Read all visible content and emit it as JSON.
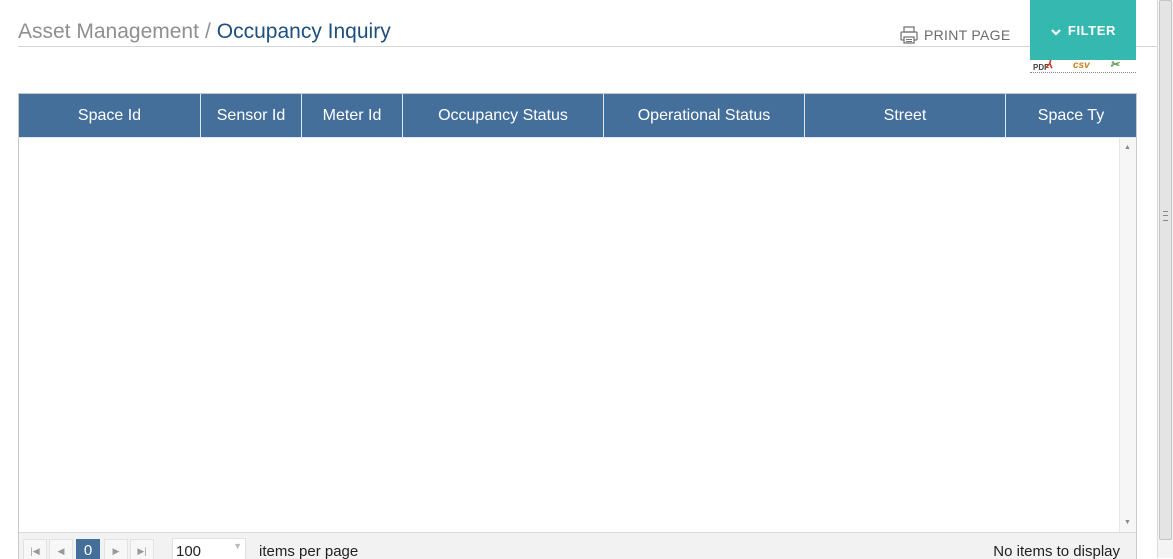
{
  "breadcrumb": {
    "parent": "Asset Management",
    "separator": "/",
    "current": "Occupancy Inquiry"
  },
  "toolbar": {
    "print_label": "PRINT PAGE",
    "print_icon": "printer-icon",
    "filter_label": "FILTER",
    "filter_icon": "chevron-down-icon",
    "export": {
      "pdf_label": "PDF",
      "csv_label": "csv",
      "excel_icon": "excel-icon"
    }
  },
  "grid": {
    "columns": [
      {
        "label": "Space Id"
      },
      {
        "label": "Sensor Id"
      },
      {
        "label": "Meter Id"
      },
      {
        "label": "Occupancy Status"
      },
      {
        "label": "Operational Status"
      },
      {
        "label": "Street"
      },
      {
        "label": "Space Ty"
      }
    ],
    "rows": [],
    "header_color": "#446f9b"
  },
  "pager": {
    "current_page": "0",
    "page_size": "100",
    "items_per_page_label": "items per page",
    "empty_message": "No items to display"
  },
  "colors": {
    "accent": "#35b8b0",
    "header": "#446f9b",
    "breadcrumb_current": "#1d4f7f"
  }
}
